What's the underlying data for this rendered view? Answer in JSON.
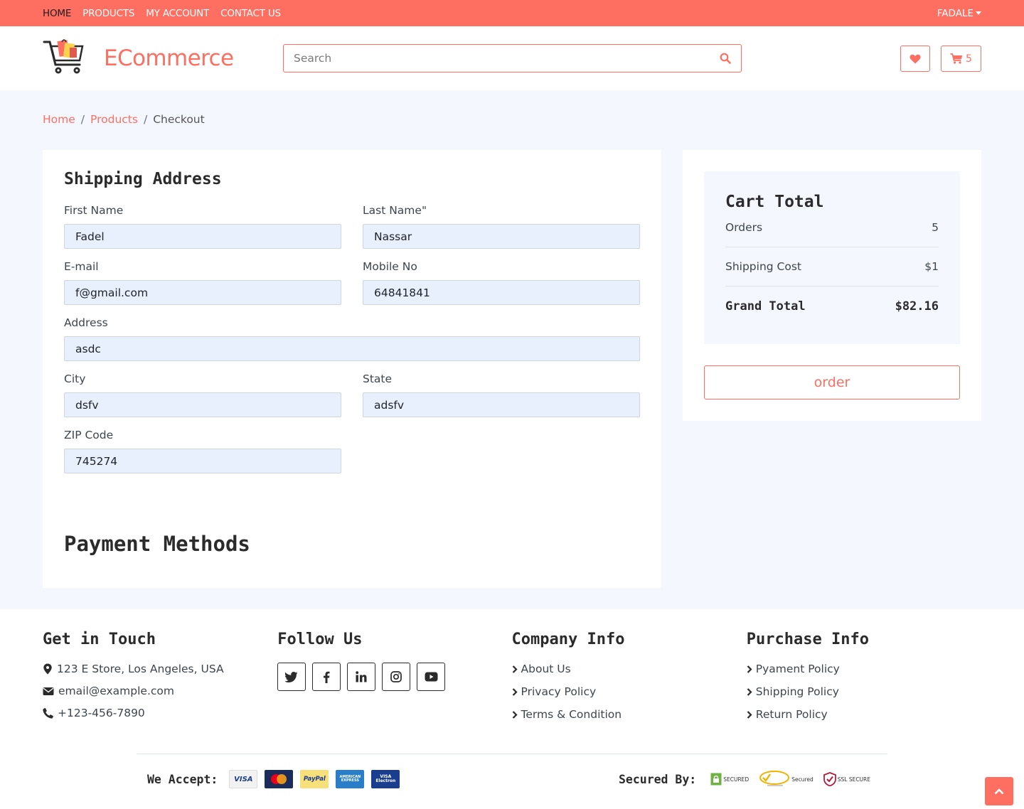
{
  "topbar": {
    "nav": [
      "HOME",
      "PRODUCTS",
      "MY ACCOUNT",
      "CONTACT US"
    ],
    "account_label": "FADALE"
  },
  "header": {
    "brand": "ECommerce",
    "search_placeholder": "Search",
    "cart_count": "5"
  },
  "breadcrumb": {
    "items": [
      "Home",
      "Products",
      "Checkout"
    ]
  },
  "shipping": {
    "title": "Shipping Address",
    "first_name": {
      "label": "First Name",
      "value": "Fadel"
    },
    "last_name": {
      "label": "Last Name\"",
      "value": "Nassar"
    },
    "email": {
      "label": "E-mail",
      "value": "f@gmail.com"
    },
    "mobile": {
      "label": "Mobile No",
      "value": "64841841"
    },
    "address": {
      "label": "Address",
      "value": "asdc"
    },
    "city": {
      "label": "City",
      "value": "dsfv"
    },
    "state": {
      "label": "State",
      "value": "adsfv"
    },
    "zip": {
      "label": "ZIP Code",
      "value": "745274"
    }
  },
  "payment": {
    "title": "Payment Methods"
  },
  "cart_total": {
    "title": "Cart Total",
    "orders_label": "Orders",
    "orders_value": "5",
    "shipping_label": "Shipping Cost",
    "shipping_value": "$1",
    "grand_label": "Grand Total",
    "grand_value": "$82.16",
    "order_button": "order"
  },
  "footer": {
    "contact": {
      "title": "Get in Touch",
      "address": "123 E Store, Los Angeles, USA",
      "email": "email@example.com",
      "phone": "+123-456-7890"
    },
    "follow": {
      "title": "Follow Us",
      "networks": [
        "twitter-icon",
        "facebook-icon",
        "linkedin-icon",
        "instagram-icon",
        "youtube-icon"
      ]
    },
    "company": {
      "title": "Company Info",
      "links": [
        "About Us",
        "Privacy Policy",
        "Terms & Condition"
      ]
    },
    "purchase": {
      "title": "Purchase Info",
      "links": [
        "Pyament Policy",
        "Shipping Policy",
        "Return Policy"
      ]
    },
    "accept_label": "We Accept:",
    "payment_cards": [
      "VISA",
      "MasterCard",
      "PayPal",
      "AMERICAN EXPRESS",
      "VISA Electron"
    ],
    "secured_label": "Secured By:",
    "seals": [
      "SECURED",
      "Secured",
      "SSL SECURE"
    ]
  },
  "colors": {
    "accent": "#ff6f61",
    "background": "#f5f7ff",
    "input_fill": "#e8f0fe"
  }
}
